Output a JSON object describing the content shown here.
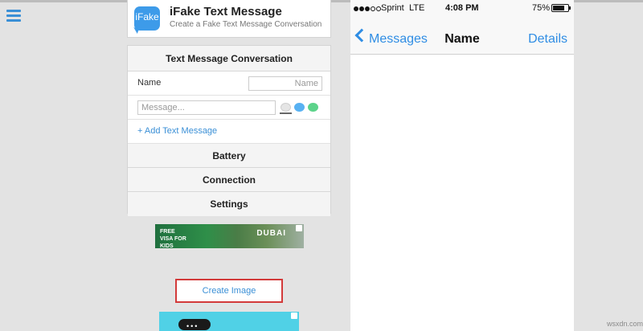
{
  "app": {
    "logo_text": "iFake",
    "title": "iFake Text Message",
    "subtitle": "Create a Fake Text Message Conversation"
  },
  "form": {
    "section_title": "Text Message Conversation",
    "name_label": "Name",
    "name_placeholder": "Name",
    "message_placeholder": "Message...",
    "add_message_label": "+ Add Text Message",
    "battery_label": "Battery",
    "connection_label": "Connection",
    "settings_label": "Settings"
  },
  "ads": {
    "banner_text": "FREE VISA FOR KIDS",
    "banner_brand": "DUBAI",
    "second_dots": "•••"
  },
  "create_button_label": "Create Image",
  "phone": {
    "carrier": "Sprint",
    "network": "LTE",
    "time": "4:08 PM",
    "battery_percent": "75%",
    "battery_level": 0.75,
    "back_label": "Messages",
    "title": "Name",
    "details_label": "Details"
  },
  "watermark": "wsxdn.com",
  "colors": {
    "accent": "#3a8fd6",
    "ios_blue": "#2f8de4",
    "highlight_border": "#d33a3a"
  }
}
